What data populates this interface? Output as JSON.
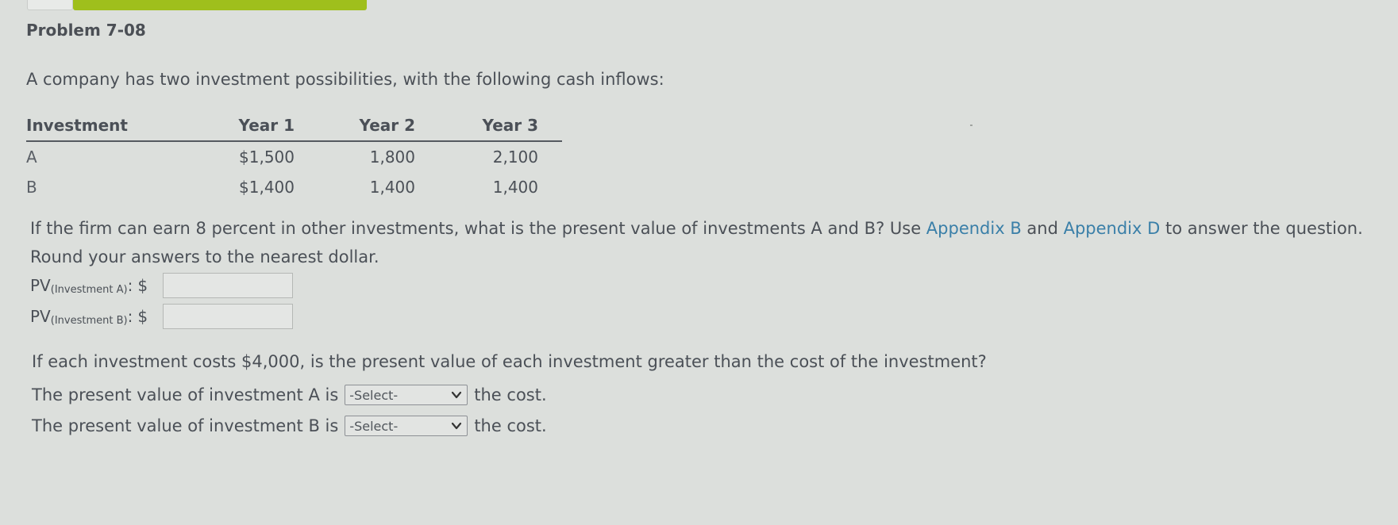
{
  "header": {
    "problem_title": "Problem 7-08",
    "accent_color": "#9fbf1c"
  },
  "intro_text": "A company has two investment possibilities, with the following cash inflows:",
  "table": {
    "columns": [
      "Investment",
      "Year 1",
      "Year 2",
      "Year 3"
    ],
    "rows": [
      {
        "investment": "A",
        "year1": "$1,500",
        "year2": "1,800",
        "year3": "2,100"
      },
      {
        "investment": "B",
        "year1": "$1,400",
        "year2": "1,400",
        "year3": "1,400"
      }
    ]
  },
  "question": {
    "part1": "If the firm can earn 8 percent in other investments, what is the present value of investments A and B? Use ",
    "link1": "Appendix B",
    "part2": " and ",
    "link2": "Appendix D",
    "part3": " to answer the question. Round your answers to the nearest dollar.",
    "link_color": "#3a7fa8"
  },
  "pv_inputs": [
    {
      "prefix": "PV",
      "subscript": "(Investment A)",
      "suffix": ":",
      "currency": "$",
      "value": ""
    },
    {
      "prefix": "PV",
      "subscript": "(Investment B)",
      "suffix": ":",
      "currency": "$",
      "value": ""
    }
  ],
  "cost_question": "If each investment costs $4,000, is the present value of each investment greater than the cost of the investment?",
  "comparisons": [
    {
      "before": "The present value of investment A is",
      "selected": "-Select-",
      "after": "the cost."
    },
    {
      "before": "The present value of investment B is",
      "selected": "-Select-",
      "after": "the cost."
    }
  ],
  "icons": {
    "select_chevron": "chevron-down-icon"
  }
}
